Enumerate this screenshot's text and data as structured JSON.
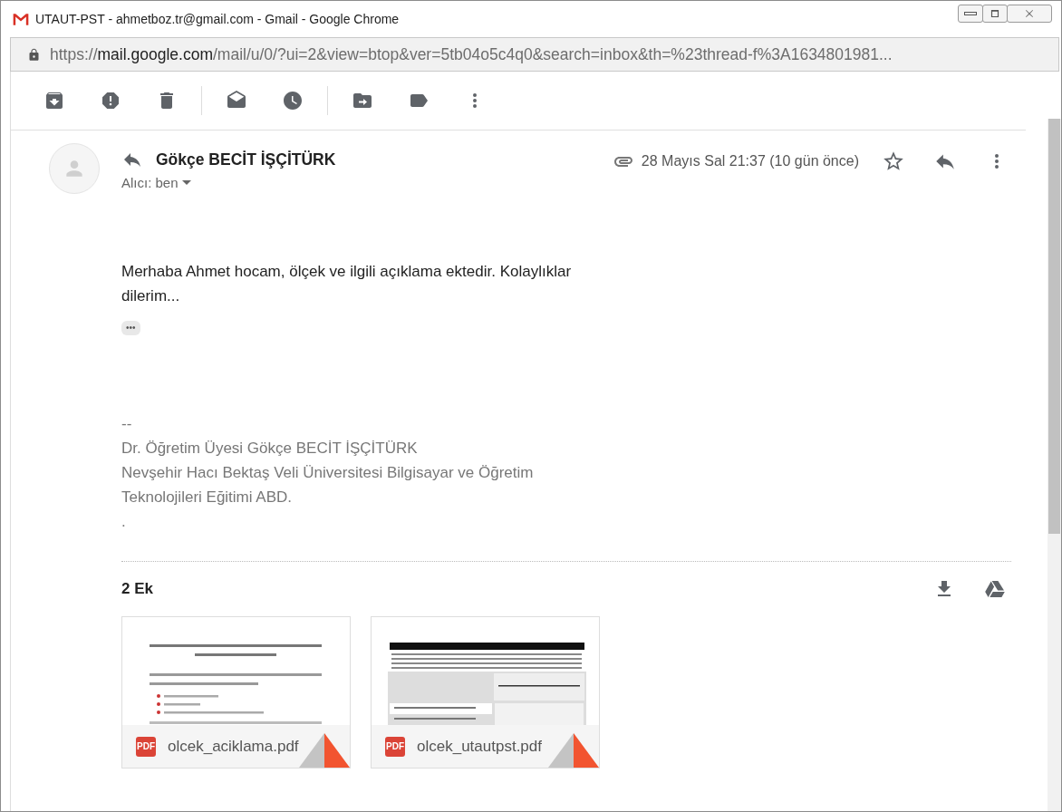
{
  "window": {
    "title": "UTAUT-PST - ahmetboz.tr@gmail.com - Gmail - Google Chrome"
  },
  "address_bar": {
    "scheme": "https://",
    "host": "mail.google.com",
    "path": "/mail/u/0/?ui=2&view=btop&ver=5tb04o5c4q0&search=inbox&th=%23thread-f%3A1634801981..."
  },
  "message": {
    "sender": "Gökçe BECİT İŞÇİTÜRK",
    "recipient": "Alıcı: ben",
    "date": "28 Mayıs Sal 21:37 (10 gün önce)",
    "starred": false,
    "body": "Merhaba Ahmet hocam, ölçek ve ilgili açıklama ektedir. Kolaylıklar dilerim...",
    "trimmed_content_button": "•••",
    "signature": [
      "--",
      "Dr. Öğretim Üyesi Gökçe BECİT İŞÇİTÜRK",
      "Nevşehir Hacı Bektaş Veli Üniversitesi Bilgisayar ve Öğretim Teknolojileri Eğitimi ABD.",
      "."
    ]
  },
  "attachments": {
    "heading": "2 Ek",
    "files": [
      {
        "name": "olcek_aciklama.pdf",
        "type_badge": "PDF",
        "kind": "text"
      },
      {
        "name": "olcek_utautpst.pdf",
        "type_badge": "PDF",
        "kind": "table"
      }
    ]
  }
}
